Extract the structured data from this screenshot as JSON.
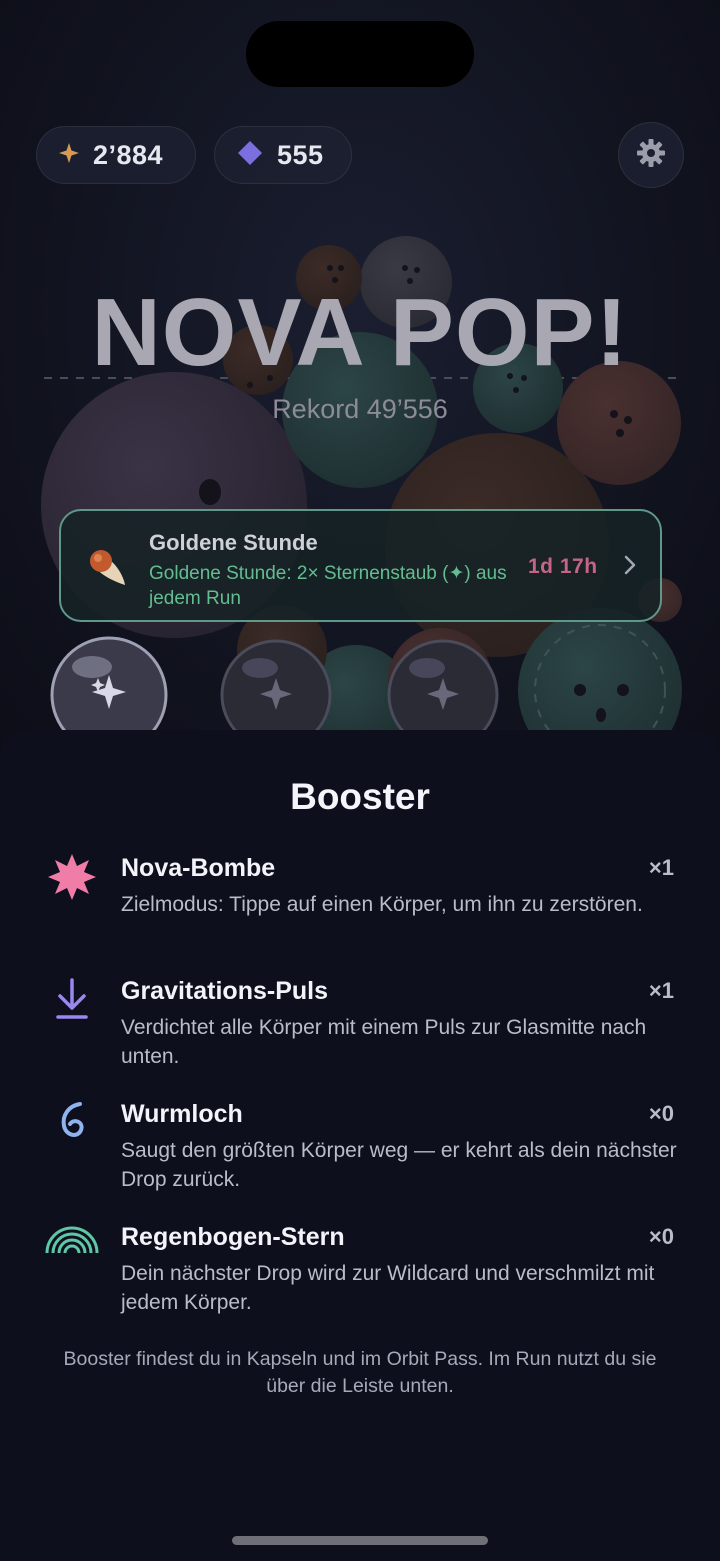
{
  "currency": {
    "stardust": "2’884",
    "gems": "555"
  },
  "title": "NOVA POP!",
  "record": "Rekord 49’556",
  "event": {
    "title": "Goldene Stunde",
    "description": "Goldene Stunde: 2× Sternenstaub (✦) aus jedem Run",
    "time": "1d 17h"
  },
  "sheet": {
    "title": "Booster",
    "boosters": [
      {
        "icon": "starburst-icon",
        "name": "Nova-Bombe",
        "description": "Zielmodus: Tippe auf einen Körper, um ihn zu zerstören.",
        "count": "×1",
        "color": "#f07ca8"
      },
      {
        "icon": "arrow-down-icon",
        "name": "Gravitations-Puls",
        "description": "Verdichtet alle Körper mit einem Puls zur Glasmitte nach unten.",
        "count": "×1",
        "color": "#9a87f0"
      },
      {
        "icon": "wormhole-icon",
        "name": "Wurmloch",
        "description": "Saugt den größten Körper weg — er kehrt als dein nächster Drop zurück.",
        "count": "×0",
        "color": "#8fb3ee"
      },
      {
        "icon": "rainbow-icon",
        "name": "Regenbogen-Stern",
        "description": "Dein nächster Drop wird zur Wildcard und verschmilzt mit jedem Körper.",
        "count": "×0",
        "color": "#5fc7a6"
      }
    ],
    "footer": "Booster findest du in Kapseln und im Orbit Pass. Im Run nutzt du sie über die Leiste unten."
  },
  "colors": {
    "stardust": "#d69a55",
    "gem": "#7b6fe0",
    "event_border": "#5f9889",
    "event_text": "#63bd90",
    "event_time": "#c46487"
  }
}
